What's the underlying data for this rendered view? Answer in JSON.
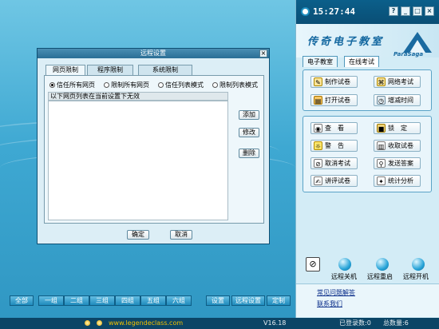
{
  "clock": "15:27:44",
  "window_buttons": [
    "?",
    "_",
    "□",
    "×"
  ],
  "brand": {
    "title": "传奇电子教室",
    "logo_text": "ParaSaga"
  },
  "right_tabs": [
    {
      "label": "电子教室",
      "active": false
    },
    {
      "label": "在线考试",
      "active": true
    }
  ],
  "exam_group": [
    {
      "label": "制作试卷",
      "icon": "edit-document-icon"
    },
    {
      "label": "网络考试",
      "icon": "network-exam-icon"
    },
    {
      "label": "打开试卷",
      "icon": "open-document-icon"
    },
    {
      "label": "增减时间",
      "icon": "clock-adjust-icon"
    }
  ],
  "tool_group": [
    {
      "label": "查　看",
      "icon": "eye-icon"
    },
    {
      "label": "锁　定",
      "icon": "lock-icon"
    },
    {
      "label": "警　告",
      "icon": "warning-icon"
    },
    {
      "label": "收取试卷",
      "icon": "collect-paper-icon"
    },
    {
      "label": "取消考试",
      "icon": "cancel-icon"
    },
    {
      "label": "发送答案",
      "icon": "send-answer-icon"
    },
    {
      "label": "讲评试卷",
      "icon": "review-icon"
    },
    {
      "label": "统计分析",
      "icon": "statistics-icon"
    }
  ],
  "power": {
    "shutdown": "远程关机",
    "restart": "远程重启",
    "poweron": "远程开机"
  },
  "links": {
    "faq": "常见问题解答",
    "contact": "联系我们"
  },
  "dialog": {
    "title": "远程设置",
    "close": "×",
    "tabs": [
      {
        "label": "网页限制",
        "active": true
      },
      {
        "label": "程序限制",
        "active": false
      },
      {
        "label": "系统限制",
        "active": false
      }
    ],
    "radios": [
      {
        "label": "信任所有网页",
        "checked": true
      },
      {
        "label": "限制所有网页",
        "checked": false
      },
      {
        "label": "信任列表模式",
        "checked": false
      },
      {
        "label": "限制列表模式",
        "checked": false
      }
    ],
    "list_header": "以下网页列表在当前设置下无效",
    "side_buttons": [
      "添加",
      "修改",
      "删除"
    ],
    "ok": "确定",
    "cancel": "取消"
  },
  "group_bar": [
    "全部",
    "一组",
    "二组",
    "三组",
    "四组",
    "五组",
    "六组"
  ],
  "action_bar": [
    "设置",
    "远程设置",
    "定制"
  ],
  "status": {
    "website": "www.legendeclass.com",
    "version": "V16.18",
    "logged_in": "已登录数:0",
    "total": "总数量:6"
  }
}
